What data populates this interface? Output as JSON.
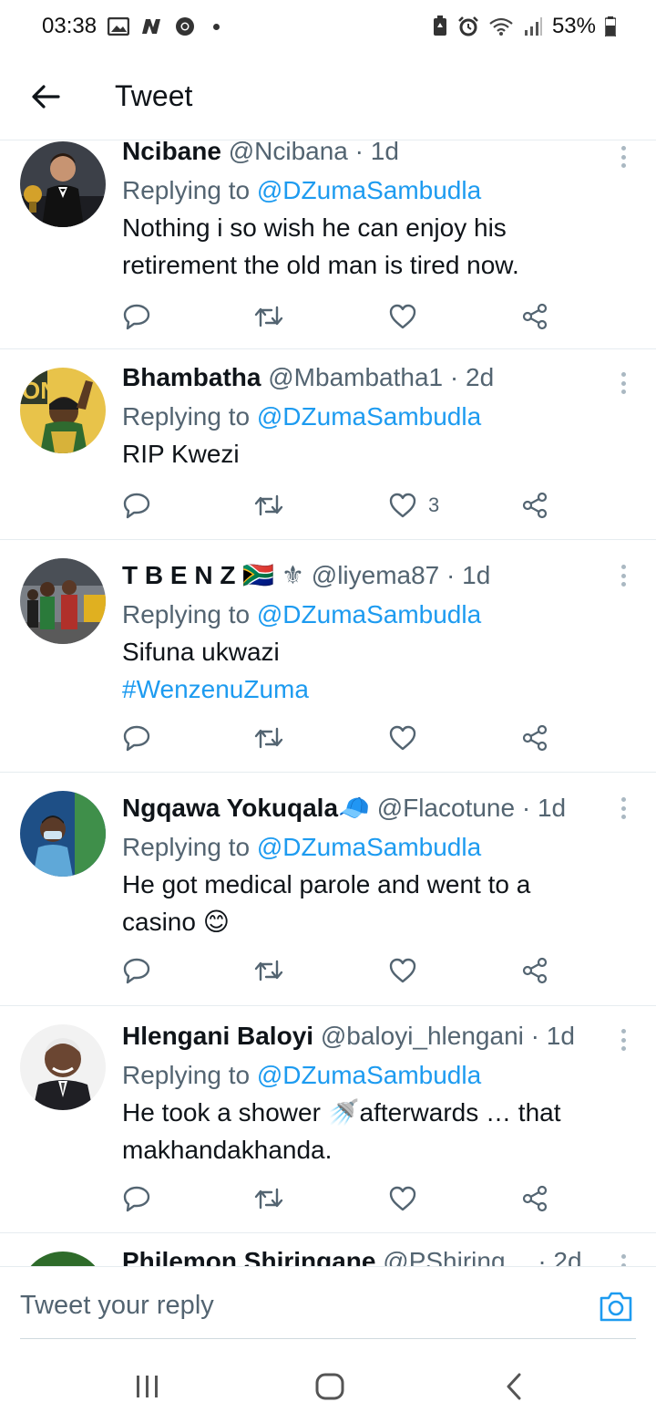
{
  "status_bar": {
    "time": "03:38",
    "battery": "53%",
    "icons": [
      "gallery-icon",
      "news-icon",
      "chrome-icon",
      "dot-icon",
      "battery-saver-icon",
      "alarm-icon",
      "wifi-icon",
      "signal-icon",
      "battery-icon"
    ]
  },
  "header": {
    "title": "Tweet",
    "back_icon": "arrow-left-icon"
  },
  "tweets": [
    {
      "name": "Ncibane",
      "handle": "@Ncibana",
      "time": "· 1d",
      "replying_prefix": "Replying to ",
      "replying_to": "@DZumaSambudla",
      "text_lines": [
        "Nothing i so wish he can enjoy his",
        "retirement the old man is tired now."
      ],
      "likes": ""
    },
    {
      "name": "Bhambatha",
      "handle": "@Mbambatha1",
      "time": "· 2d",
      "replying_prefix": "Replying to ",
      "replying_to": "@DZumaSambudla",
      "text_lines": [
        "RIP Kwezi"
      ],
      "likes": "3"
    },
    {
      "name": "T B E N Z",
      "name_emoji": "🇿🇦 ⚜",
      "handle": "@liyema87",
      "time": "· 1d",
      "replying_prefix": "Replying to ",
      "replying_to": "@DZumaSambudla",
      "text_lines": [
        "Sifuna ukwazi"
      ],
      "hashtag": "#WenzenuZuma",
      "likes": ""
    },
    {
      "name": "Ngqawa Yokuqala",
      "name_emoji": "🧢",
      "handle": "@Flacotune",
      "time": "· 1d",
      "replying_prefix": "Replying to ",
      "replying_to": "@DZumaSambudla",
      "text_lines": [
        "He got medical parole and went to a",
        "casino 😊"
      ],
      "likes": ""
    },
    {
      "name": "Hlengani Baloyi",
      "handle": "@baloyi_hlengani",
      "time": "· 1d",
      "replying_prefix": "Replying to ",
      "replying_to": "@DZumaSambudla",
      "text_lines": [
        "He took a shower 🚿afterwards … that",
        "makhandakhanda."
      ],
      "likes": ""
    },
    {
      "name": "Philemon Shiringane",
      "handle": "@PShiring…",
      "time": "· 2d"
    }
  ],
  "reply_bar": {
    "placeholder": "Tweet your reply",
    "camera_icon": "camera-icon"
  },
  "nav_bar": {
    "icons": [
      "recents-icon",
      "home-icon",
      "back-icon"
    ]
  },
  "colors": {
    "accent": "#1d9bf0",
    "text": "#0f1419",
    "muted": "#536471",
    "divider": "#e6ecf0"
  }
}
